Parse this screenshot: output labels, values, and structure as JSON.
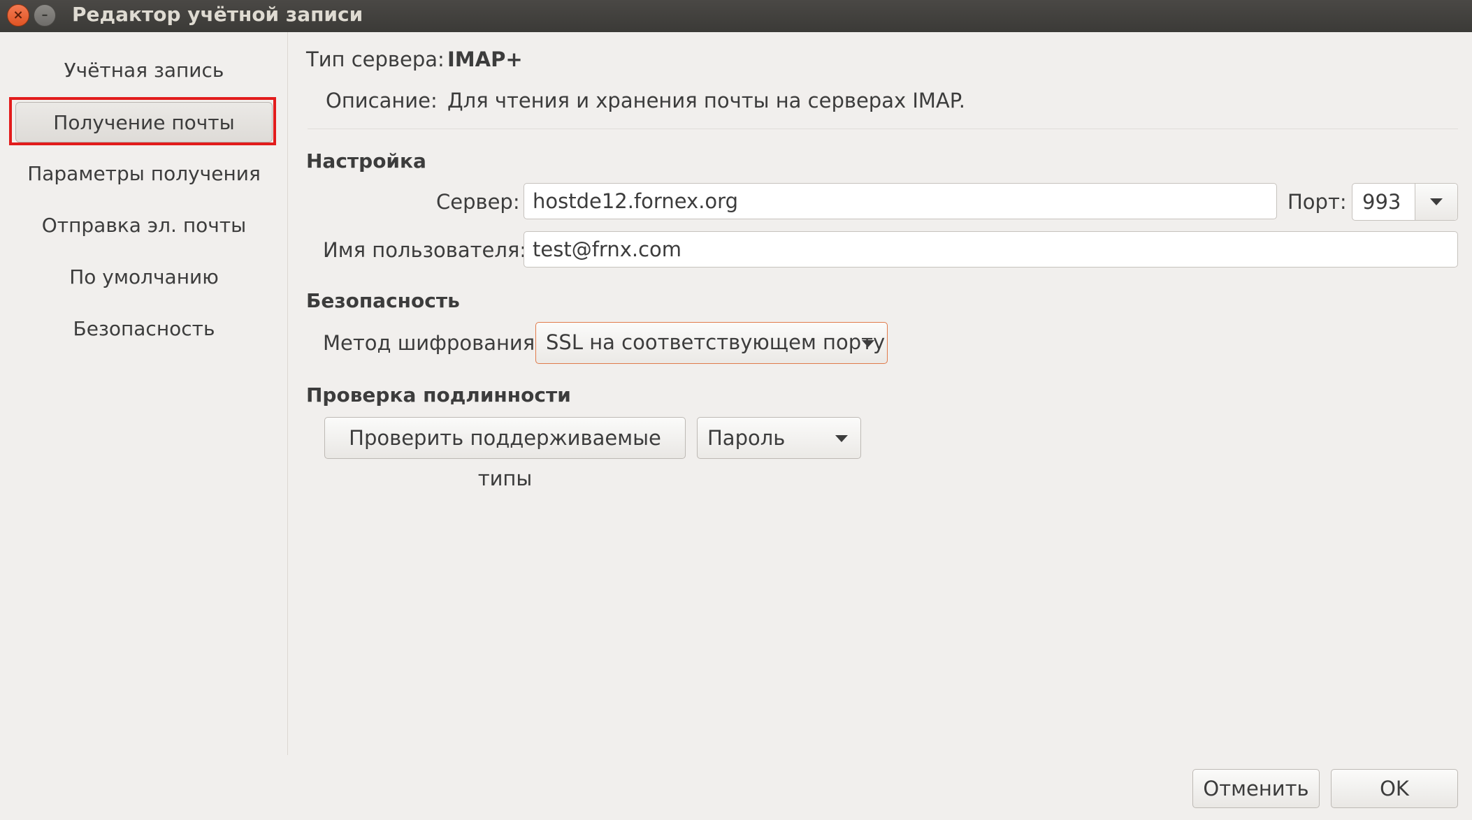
{
  "window": {
    "title": "Редактор учётной записи"
  },
  "sidebar": {
    "items": [
      {
        "label": "Учётная запись"
      },
      {
        "label": "Получение почты"
      },
      {
        "label": "Параметры получения"
      },
      {
        "label": "Отправка эл. почты"
      },
      {
        "label": "По умолчанию"
      },
      {
        "label": "Безопасность"
      }
    ],
    "selected_index": 1
  },
  "server_info": {
    "type_label": "Тип сервера:",
    "type_value": "IMAP+",
    "description_label": "Описание:",
    "description_value": "Для чтения и хранения почты на серверах IMAP."
  },
  "settings": {
    "heading": "Настройка",
    "server_label": "Сервер:",
    "server_value": "hostde12.fornex.org",
    "port_label": "Порт:",
    "port_value": "993",
    "username_label": "Имя пользователя:",
    "username_value": "test@frnx.com"
  },
  "security": {
    "heading": "Безопасность",
    "encryption_label": "Метод шифрования:",
    "encryption_value": "SSL на соответствующем порту"
  },
  "auth": {
    "heading": "Проверка подлинности",
    "check_button_label": "Проверить поддерживаемые типы",
    "method_value": "Пароль"
  },
  "footer": {
    "cancel_label": "Отменить",
    "ok_label": "OK"
  },
  "colors": {
    "highlight_border": "#e21c1c",
    "focus_border": "#e07a4a",
    "window_background": "#f1efed",
    "titlebar": "#3b3a37"
  }
}
